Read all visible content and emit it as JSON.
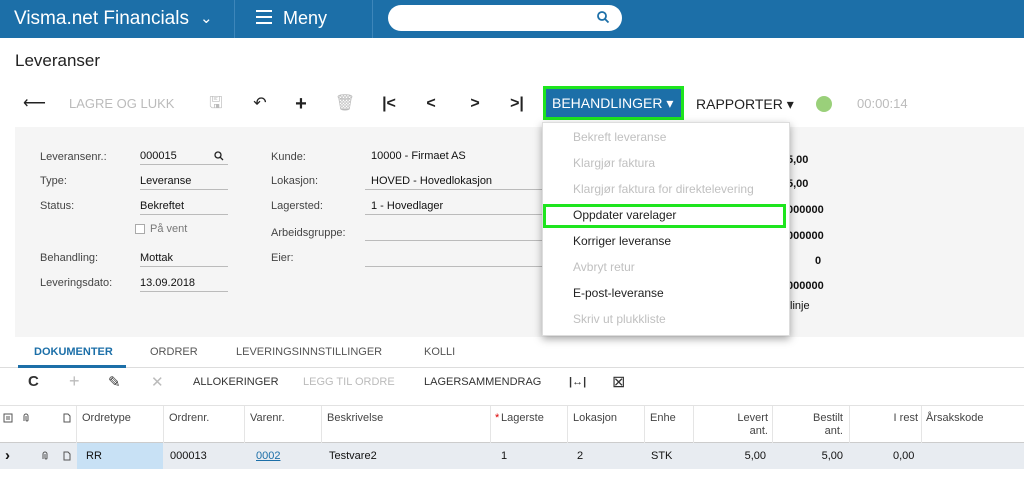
{
  "topbar": {
    "brand": "Visma.net Financials",
    "brand_chevron": "⌄",
    "menu_label": "Meny",
    "search_placeholder": ""
  },
  "page_title": "Leveranser",
  "toolbar": {
    "back_glyph": "⟵",
    "save_close_label": "LAGRE OG LUKK",
    "save_glyph": "🖫",
    "undo_glyph": "↶",
    "add_glyph": "+",
    "delete_glyph": "🗑",
    "first_glyph": "|<",
    "prev_glyph": "<",
    "next_glyph": ">",
    "last_glyph": ">|",
    "behandlinger_label": "BEHANDLINGER ▾",
    "rapporter_label": "RAPPORTER ▾",
    "timer": "00:00:14"
  },
  "form": {
    "leveransenr_label": "Leveransenr.:",
    "leveransenr_value": "000015",
    "type_label": "Type:",
    "type_value": "Leveranse",
    "status_label": "Status:",
    "status_value": "Bekreftet",
    "pa_vent_label": "På vent",
    "behandling_label": "Behandling:",
    "behandling_value": "Mottak",
    "leveringsdato_label": "Leveringsdato:",
    "leveringsdato_value": "13.09.2018",
    "kunde_label": "Kunde:",
    "kunde_value": "10000 - Firmaet AS",
    "lokasjon_label": "Lokasjon:",
    "lokasjon_value": "HOVED - Hovedlokasjon",
    "lagersted_label": "Lagersted:",
    "lagersted_value": "1 - Hovedlager",
    "arbeidsgruppe_label": "Arbeidsgruppe:",
    "eier_label": "Eier:",
    "right_values": [
      "5,00",
      "5,00",
      "000000",
      "000000",
      "0",
      "000000",
      "linje"
    ]
  },
  "dropdown": {
    "items": [
      {
        "label": "Bekreft leveranse",
        "enabled": false
      },
      {
        "label": "Klargjør faktura",
        "enabled": false
      },
      {
        "label": "Klargjør faktura for direktelevering",
        "enabled": false
      },
      {
        "label": "Oppdater varelager",
        "enabled": true
      },
      {
        "label": "Korriger leveranse",
        "enabled": true
      },
      {
        "label": "Avbryt retur",
        "enabled": false
      },
      {
        "label": "E-post-leveranse",
        "enabled": true
      },
      {
        "label": "Skriv ut plukkliste",
        "enabled": false
      }
    ]
  },
  "tabs": [
    "DOKUMENTER",
    "ORDRER",
    "LEVERINGSINNSTILLINGER",
    "KOLLI"
  ],
  "gridbar": {
    "refresh_glyph": "C",
    "add_glyph": "+",
    "edit_glyph": "✎",
    "delete_glyph": "✕",
    "allokeringer": "ALLOKERINGER",
    "legg_til_ordre": "LEGG TIL ORDRE",
    "lagersammendrag": "LAGERSAMMENDRAG",
    "fit_glyph": "|↔|",
    "excel_glyph": "⊠"
  },
  "table": {
    "headers": {
      "ordretype": "Ordretype",
      "ordrenr": "Ordrenr.",
      "varenr": "Varenr.",
      "beskrivelse": "Beskrivelse",
      "lagersted_star": "*",
      "lagersted": "Lagerste",
      "lokasjon": "Lokasjon",
      "enhet": "Enhe",
      "levert_1": "Levert",
      "levert_2": "ant.",
      "bestilt_1": "Bestilt",
      "bestilt_2": "ant.",
      "i_rest": "I rest",
      "arsakskode": "Årsakskode"
    },
    "row": {
      "expand": "›",
      "ordretype": "RR",
      "ordrenr": "000013",
      "varenr": "0002",
      "beskrivelse": "Testvare2",
      "lagersted": "1",
      "lokasjon": "2",
      "enhet": "STK",
      "levert": "5,00",
      "bestilt": "5,00",
      "i_rest": "0,00"
    }
  },
  "colors": {
    "brand_blue": "#1c6fa8",
    "highlight_green": "#1ee51e"
  }
}
